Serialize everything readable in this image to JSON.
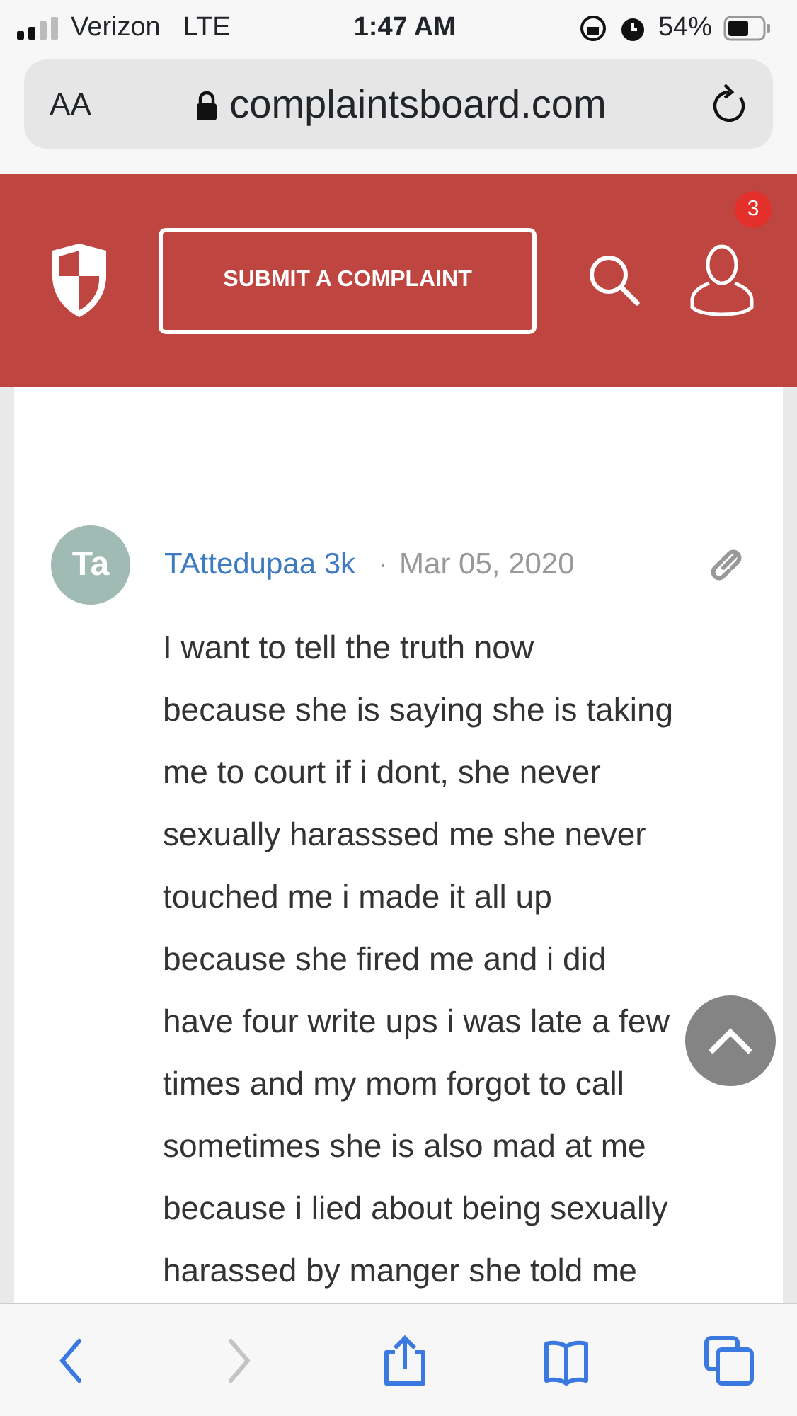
{
  "status_bar": {
    "carrier": "Verizon",
    "network": "LTE",
    "time": "1:47 AM",
    "battery": "54%"
  },
  "address_bar": {
    "text_size": "AA",
    "url": "complaintsboard.com"
  },
  "header": {
    "submit_button": "SUBMIT A COMPLAINT",
    "notification_count": "3"
  },
  "comment": {
    "avatar": "Ta",
    "author": "TAttedupaa 3k",
    "separator": "·",
    "date": "Mar 05, 2020",
    "lines": [
      "I want to tell the truth now",
      "because she is saying she is taking",
      "me to court if i dont, she never",
      "sexually harasssed me she never",
      "touched me i made it all up",
      "because she fired me and i did",
      "have four write ups i was late a few",
      "times and my mom forgot to call",
      "sometimes she is also mad at me",
      "because i lied about being sexually",
      "harassed by manger she told me"
    ]
  },
  "toolbar": [
    {
      "kind": "back",
      "disabled": false
    },
    {
      "kind": "forward",
      "disabled": true
    },
    {
      "kind": "share",
      "disabled": false
    },
    {
      "kind": "bookmarks",
      "disabled": false
    },
    {
      "kind": "tabs",
      "disabled": false
    }
  ]
}
